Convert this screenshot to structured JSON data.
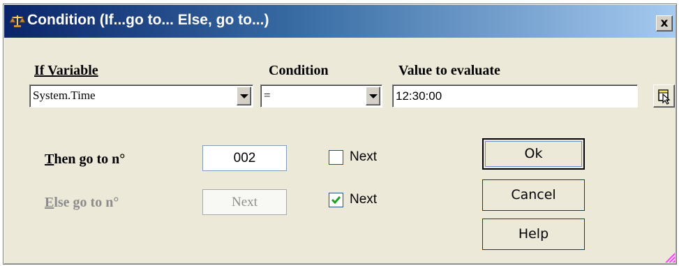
{
  "window": {
    "title": "Condition (If...go to... Else, go to...)",
    "close_label": "x",
    "title_icon": "scale-icon"
  },
  "headers": {
    "if_variable": "If Variable",
    "condition": "Condition",
    "value_to_evaluate": "Value to evaluate"
  },
  "if_variable": {
    "value": "System.Time"
  },
  "condition": {
    "value": "="
  },
  "value_to_evaluate": {
    "value": "12:30:00"
  },
  "then": {
    "label_first": "T",
    "label_rest": "hen go to n°",
    "value": "002",
    "next_label": "Next",
    "next_checked": false
  },
  "else": {
    "label_first": "E",
    "label_rest": "lse go to n°",
    "value": "Next",
    "next_label": "Next",
    "next_checked": true,
    "disabled": true
  },
  "buttons": {
    "ok": "Ok",
    "cancel": "Cancel",
    "help": "Help"
  },
  "colors": {
    "title_start": "#0a246a",
    "title_end": "#a6caf0",
    "dialog_bg": "#ece9d8",
    "check_mark": "#21a121"
  }
}
